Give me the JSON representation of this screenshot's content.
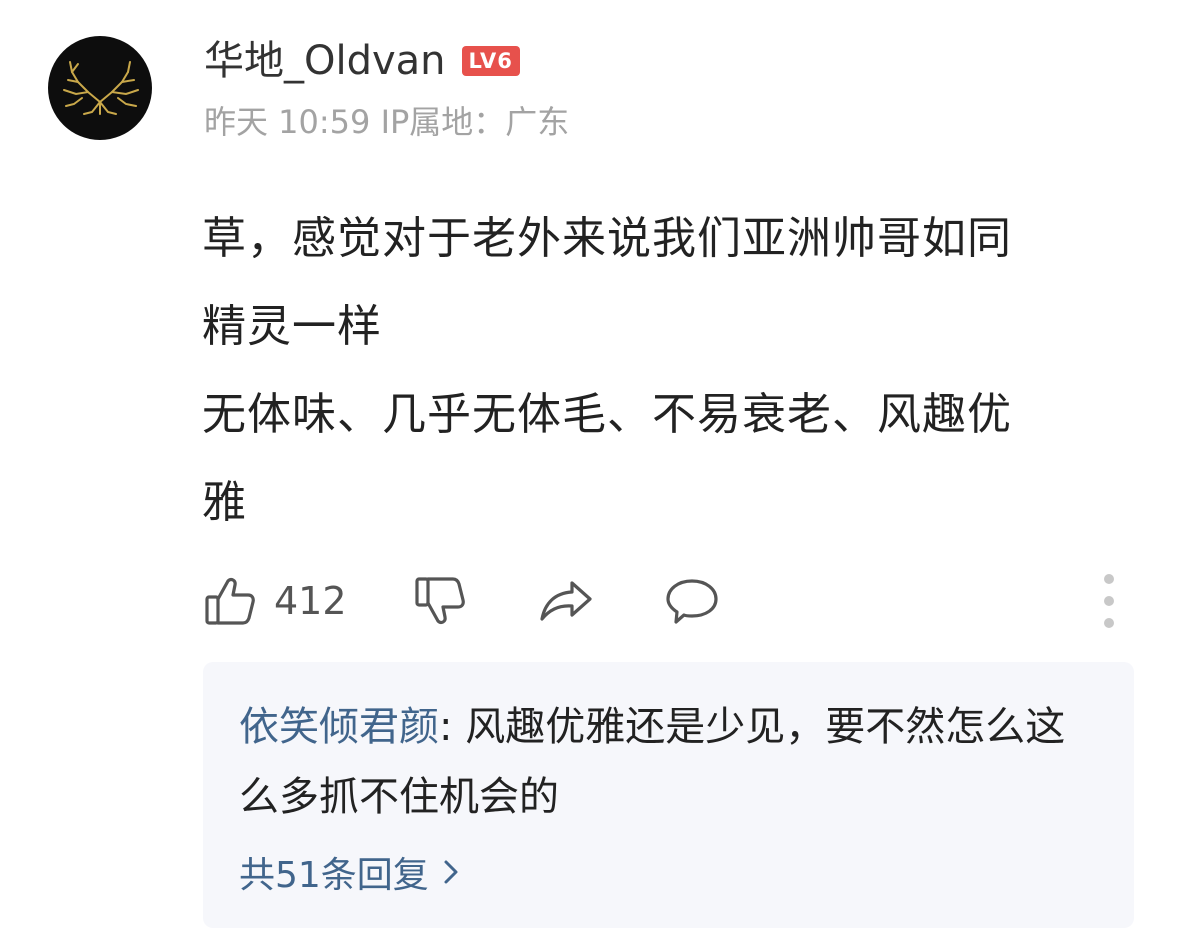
{
  "comment": {
    "avatar_icon": "deer-antler-icon",
    "username": "华地_Oldvan",
    "level_badge": "LV6",
    "meta": "昨天 10:59 IP属地：广东",
    "body_lines": [
      "草，感觉对于老外来说我们亚洲帅哥如同",
      "精灵一样",
      "无体味、几乎无体毛、不易衰老、风趣优",
      "雅"
    ],
    "actions": {
      "like_icon": "thumbs-up-icon",
      "like_count": "412",
      "dislike_icon": "thumbs-down-icon",
      "share_icon": "share-arrow-icon",
      "reply_icon": "comment-bubble-icon",
      "more_icon": "more-vertical-icon"
    },
    "reply_preview": {
      "author": "依笑倾君颜",
      "separator": ": ",
      "text": "风趣优雅还是少见，要不然怎么这么多抓不住机会的",
      "count_label": "共51条回复",
      "chevron_icon": "chevron-right-icon"
    }
  },
  "colors": {
    "username": "#333333",
    "meta": "#a3a3a3",
    "badge": "#e7514c",
    "reply_author": "#41658c",
    "reply_background": "#f6f7fb",
    "icon": "#555555"
  }
}
